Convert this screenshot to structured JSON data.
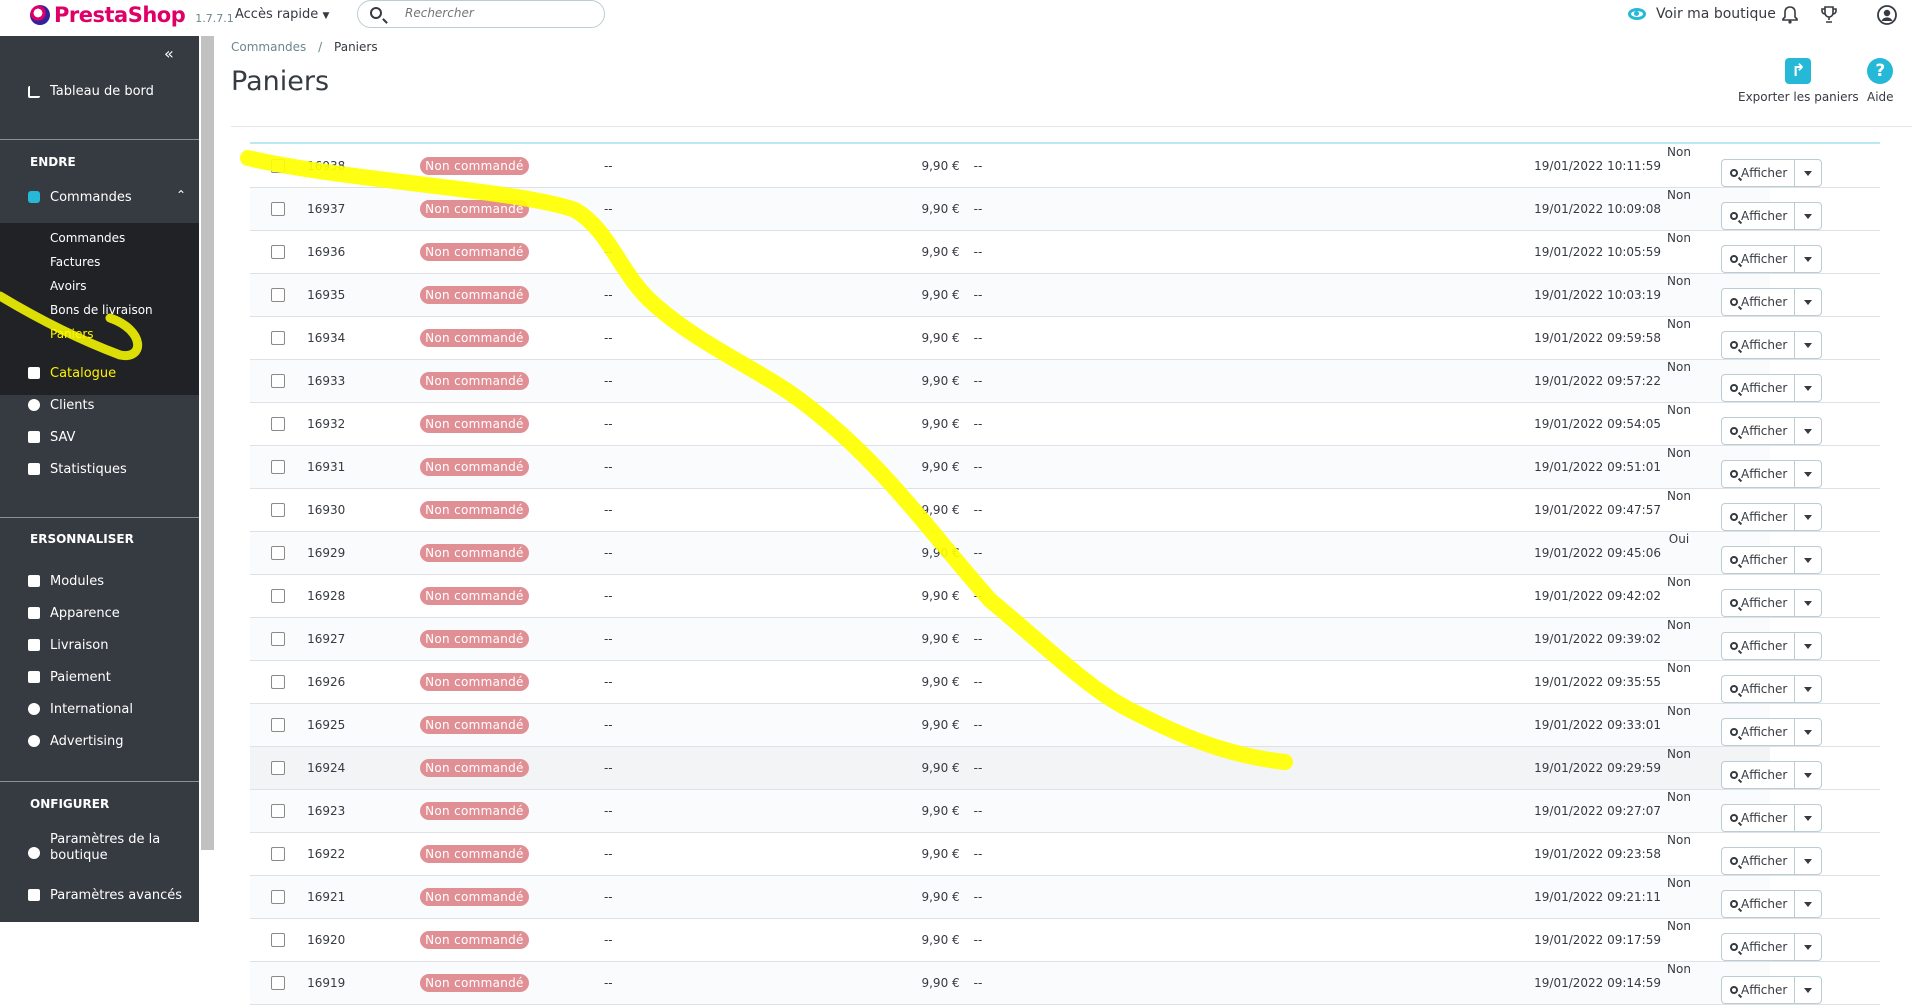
{
  "header": {
    "brand": "PrestaShop",
    "version": "1.7.7.1",
    "quick_access": "Accès rapide",
    "search_placeholder": "Rechercher",
    "view_shop": "Voir ma boutique"
  },
  "sidebar": {
    "dashboard": "Tableau de bord",
    "section_sell": "ENDRE",
    "orders_menu": "Commandes",
    "sub_items": [
      "Commandes",
      "Factures",
      "Avoirs",
      "Bons de livraison",
      "Paniers"
    ],
    "items_sell": [
      "Catalogue",
      "Clients",
      "SAV",
      "Statistiques"
    ],
    "section_customize": "ERSONNALISER",
    "items_customize": [
      "Modules",
      "Apparence",
      "Livraison",
      "Paiement",
      "International",
      "Advertising"
    ],
    "section_configure": "ONFIGURER",
    "items_configure": [
      "Paramètres de la boutique",
      "Paramètres avancés"
    ]
  },
  "breadcrumb": {
    "parent": "Commandes",
    "separator": "/",
    "current": "Paniers"
  },
  "page_title": "Paniers",
  "toolbar": {
    "export_label": "Exporter les paniers",
    "help_label": "Aide"
  },
  "table": {
    "status_label": "Non commandé",
    "rows": [
      {
        "id": "16938",
        "customer": "--",
        "total": "9,90 €",
        "carrier": "--",
        "date": "19/01/2022 10:11:59",
        "online": "Non"
      },
      {
        "id": "16937",
        "customer": "--",
        "total": "9,90 €",
        "carrier": "--",
        "date": "19/01/2022 10:09:08",
        "online": "Non"
      },
      {
        "id": "16936",
        "customer": "--",
        "total": "9,90 €",
        "carrier": "--",
        "date": "19/01/2022 10:05:59",
        "online": "Non"
      },
      {
        "id": "16935",
        "customer": "--",
        "total": "9,90 €",
        "carrier": "--",
        "date": "19/01/2022 10:03:19",
        "online": "Non"
      },
      {
        "id": "16934",
        "customer": "--",
        "total": "9,90 €",
        "carrier": "--",
        "date": "19/01/2022 09:59:58",
        "online": "Non"
      },
      {
        "id": "16933",
        "customer": "--",
        "total": "9,90 €",
        "carrier": "--",
        "date": "19/01/2022 09:57:22",
        "online": "Non"
      },
      {
        "id": "16932",
        "customer": "--",
        "total": "9,90 €",
        "carrier": "--",
        "date": "19/01/2022 09:54:05",
        "online": "Non"
      },
      {
        "id": "16931",
        "customer": "--",
        "total": "9,90 €",
        "carrier": "--",
        "date": "19/01/2022 09:51:01",
        "online": "Non"
      },
      {
        "id": "16930",
        "customer": "--",
        "total": "9,90 €",
        "carrier": "--",
        "date": "19/01/2022 09:47:57",
        "online": "Non"
      },
      {
        "id": "16929",
        "customer": "--",
        "total": "9,90 €",
        "carrier": "--",
        "date": "19/01/2022 09:45:06",
        "online": "Oui"
      },
      {
        "id": "16928",
        "customer": "--",
        "total": "9,90 €",
        "carrier": "--",
        "date": "19/01/2022 09:42:02",
        "online": "Non"
      },
      {
        "id": "16927",
        "customer": "--",
        "total": "9,90 €",
        "carrier": "--",
        "date": "19/01/2022 09:39:02",
        "online": "Non"
      },
      {
        "id": "16926",
        "customer": "--",
        "total": "9,90 €",
        "carrier": "--",
        "date": "19/01/2022 09:35:55",
        "online": "Non"
      },
      {
        "id": "16925",
        "customer": "--",
        "total": "9,90 €",
        "carrier": "--",
        "date": "19/01/2022 09:33:01",
        "online": "Non"
      },
      {
        "id": "16924",
        "customer": "--",
        "total": "9,90 €",
        "carrier": "--",
        "date": "19/01/2022 09:29:59",
        "online": "Non"
      },
      {
        "id": "16923",
        "customer": "--",
        "total": "9,90 €",
        "carrier": "--",
        "date": "19/01/2022 09:27:07",
        "online": "Non"
      },
      {
        "id": "16922",
        "customer": "--",
        "total": "9,90 €",
        "carrier": "--",
        "date": "19/01/2022 09:23:58",
        "online": "Non"
      },
      {
        "id": "16921",
        "customer": "--",
        "total": "9,90 €",
        "carrier": "--",
        "date": "19/01/2022 09:21:11",
        "online": "Non"
      },
      {
        "id": "16920",
        "customer": "--",
        "total": "9,90 €",
        "carrier": "--",
        "date": "19/01/2022 09:17:59",
        "online": "Non"
      },
      {
        "id": "16919",
        "customer": "--",
        "total": "9,90 €",
        "carrier": "--",
        "date": "19/01/2022 09:14:59",
        "online": "Non"
      }
    ],
    "view_label": "Afficher"
  },
  "colors": {
    "brand": "#df0067",
    "accent": "#25b9d7",
    "sidebar_bg": "#363a41",
    "badge": "#e08f95",
    "highlighter": "#ffff00"
  }
}
